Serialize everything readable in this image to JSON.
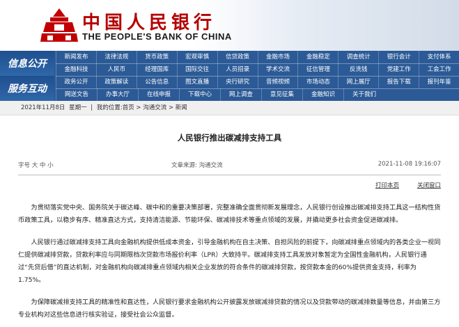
{
  "header": {
    "cn_title": "中国人民银行",
    "en_title": "THE PEOPLE'S BANK OF CHINA"
  },
  "nav": {
    "section1": "信息公开",
    "section2": "服务互动",
    "row1": [
      "新闻发布",
      "法律法规",
      "货币政策",
      "宏观审慎",
      "信贷政策",
      "金融市场",
      "金融稳定",
      "调查统计",
      "银行会计",
      "支付体系"
    ],
    "row2": [
      "金融科技",
      "人民币",
      "经理国库",
      "国际交往",
      "人员招录",
      "学术交流",
      "征信管理",
      "反洗钱",
      "党建工作",
      "工会工作"
    ],
    "row3": [
      "政务公开",
      "政策解读",
      "公告信息",
      "图文直播",
      "央行研究",
      "音频视频",
      "市场动态",
      "网上展厅",
      "报告下载",
      "报刊年鉴"
    ],
    "row4": [
      "网送文告",
      "办事大厅",
      "在线申报",
      "下载中心",
      "网上调查",
      "意见征集",
      "金融知识",
      "关于我们"
    ]
  },
  "breadcrumb": {
    "date": "2021年11月8日",
    "weekday": "星期一",
    "location": "我的位置:首页 > 沟通交流 > 新闻"
  },
  "article": {
    "title": "人民银行推出碳减排支持工具",
    "font_label": "字号",
    "font_sizes": "大 中 小",
    "source": "文章来源:  沟通交流",
    "datetime": "2021-11-08 19:16:07",
    "print": "打印本页",
    "close": "关闭窗口",
    "p1": "为贯彻落实党中央、国务院关于碳达峰、碳中和的重要决策部署，完整准确全面贯彻新发展理念，人民银行创设推出碳减排支持工具这一结构性货币政策工具，以稳步有序、精准直达方式，支持清洁能源、节能环保、碳减排技术等重点领域的发展，并撬动更多社会资金促进碳减排。",
    "p2": "人民银行通过碳减排支持工具向金融机构提供低成本资金，引导金融机构在自主决策、自担风险的前提下，向碳减排重点领域内的各类企业一视同仁提供碳减排贷款，贷款利率应与同期限档次贷款市场报价利率（LPR）大致持平。碳减排支持工具发放对象暂定为全国性金融机构，人民银行通过“先贷后借”的直达机制，对金融机构向碳减排重点领域内相关企业发放的符合条件的碳减排贷款，按贷款本金的60%提供资金支持，利率为1.75%。",
    "p3": "为保障碳减排支持工具的精准性和直达性，人民银行要求金融机构公开披露发放碳减排贷款的情况以及贷款带动的碳减排数量等信息，并由第三方专业机构对这些信息进行核实验证，接受社会公众监督。"
  },
  "colors": {
    "nav": "#2b5a96",
    "brand_red": "#b40000"
  }
}
